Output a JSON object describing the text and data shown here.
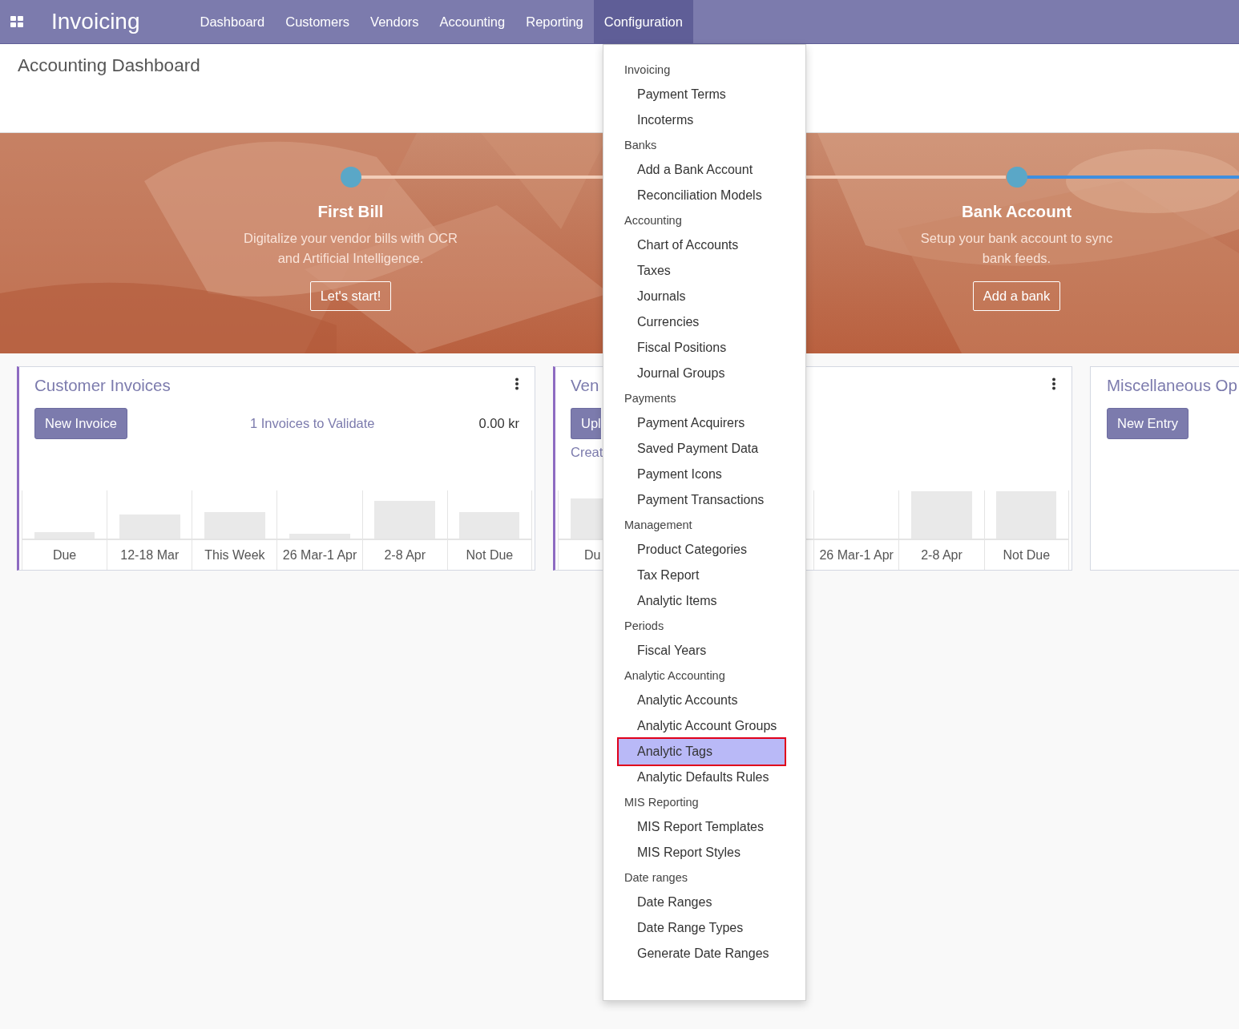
{
  "navbar": {
    "app_name": "Invoicing",
    "menus": [
      {
        "label": "Dashboard",
        "selected": false
      },
      {
        "label": "Customers",
        "selected": false
      },
      {
        "label": "Vendors",
        "selected": false
      },
      {
        "label": "Accounting",
        "selected": false
      },
      {
        "label": "Reporting",
        "selected": false
      },
      {
        "label": "Configuration",
        "selected": true
      }
    ]
  },
  "breadcrumb": "Accounting Dashboard",
  "onboarding": {
    "steps": [
      {
        "title": "First Bill",
        "description_lines": [
          "Digitalize your vendor bills with OCR",
          "and Artificial Intelligence."
        ],
        "button": "Let's start!"
      },
      {
        "title": "Bank Account",
        "description_lines": [
          "Setup your bank account to sync",
          "bank feeds."
        ],
        "button": "Add a bank"
      }
    ]
  },
  "cards": [
    {
      "kind": "sales",
      "title": "Customer Invoices",
      "options_menu": true,
      "button": "New Invoice",
      "link": "1 Invoices to Validate",
      "amount": "0.00 kr",
      "columns": [
        {
          "label": "Due"
        },
        {
          "label": "12-18 Mar"
        },
        {
          "label": "This Week"
        },
        {
          "label": "26 Mar-1 Apr"
        },
        {
          "label": "2-8 Apr"
        },
        {
          "label": "Not Due"
        }
      ]
    },
    {
      "kind": "purchase",
      "title": "Ven",
      "options_menu": true,
      "button": "Upl",
      "link": "Creat",
      "columns": [
        {
          "label": "Du"
        },
        {
          "label": "26 Mar-1 Apr"
        },
        {
          "label": "2-8 Apr"
        },
        {
          "label": "Not Due"
        }
      ]
    },
    {
      "kind": "general",
      "title": "Miscellaneous Op",
      "options_menu": false,
      "button": "New Entry"
    }
  ],
  "config_menu": {
    "entries": [
      {
        "kind": "header",
        "label": "Invoicing"
      },
      {
        "kind": "item",
        "label": "Payment Terms",
        "selected": false
      },
      {
        "kind": "item",
        "label": "Incoterms",
        "selected": false
      },
      {
        "kind": "header",
        "label": "Banks"
      },
      {
        "kind": "item",
        "label": "Add a Bank Account",
        "selected": false
      },
      {
        "kind": "item",
        "label": "Reconciliation Models",
        "selected": false
      },
      {
        "kind": "header",
        "label": "Accounting"
      },
      {
        "kind": "item",
        "label": "Chart of Accounts",
        "selected": false
      },
      {
        "kind": "item",
        "label": "Taxes",
        "selected": false
      },
      {
        "kind": "item",
        "label": "Journals",
        "selected": false
      },
      {
        "kind": "item",
        "label": "Currencies",
        "selected": false
      },
      {
        "kind": "item",
        "label": "Fiscal Positions",
        "selected": false
      },
      {
        "kind": "item",
        "label": "Journal Groups",
        "selected": false
      },
      {
        "kind": "header",
        "label": "Payments"
      },
      {
        "kind": "item",
        "label": "Payment Acquirers",
        "selected": false
      },
      {
        "kind": "item",
        "label": "Saved Payment Data",
        "selected": false
      },
      {
        "kind": "item",
        "label": "Payment Icons",
        "selected": false
      },
      {
        "kind": "item",
        "label": "Payment Transactions",
        "selected": false
      },
      {
        "kind": "header",
        "label": "Management"
      },
      {
        "kind": "item",
        "label": "Product Categories",
        "selected": false
      },
      {
        "kind": "item",
        "label": "Tax Report",
        "selected": false
      },
      {
        "kind": "item",
        "label": "Analytic Items",
        "selected": false
      },
      {
        "kind": "header",
        "label": "Periods"
      },
      {
        "kind": "item",
        "label": "Fiscal Years",
        "selected": false
      },
      {
        "kind": "header",
        "label": "Analytic Accounting"
      },
      {
        "kind": "item",
        "label": "Analytic Accounts",
        "selected": false
      },
      {
        "kind": "item",
        "label": "Analytic Account Groups",
        "selected": false
      },
      {
        "kind": "item",
        "label": "Analytic Tags",
        "selected": true
      },
      {
        "kind": "item",
        "label": "Analytic Defaults Rules",
        "selected": false
      },
      {
        "kind": "header",
        "label": "MIS Reporting"
      },
      {
        "kind": "item",
        "label": "MIS Report Templates",
        "selected": false
      },
      {
        "kind": "item",
        "label": "MIS Report Styles",
        "selected": false
      },
      {
        "kind": "header",
        "label": "Date ranges"
      },
      {
        "kind": "item",
        "label": "Date Ranges",
        "selected": false
      },
      {
        "kind": "item",
        "label": "Date Range Types",
        "selected": false
      },
      {
        "kind": "item",
        "label": "Generate Date Ranges",
        "selected": false
      }
    ]
  }
}
